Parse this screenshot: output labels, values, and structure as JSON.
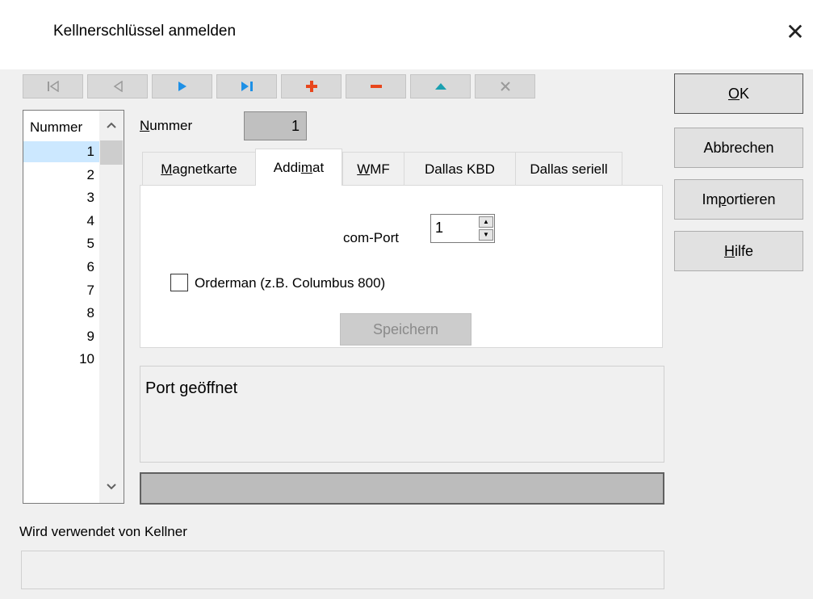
{
  "window": {
    "title": "Kellnerschlüssel anmelden",
    "close_glyph": "✕"
  },
  "nav": [
    {
      "name": "first-record-button",
      "icon": "first-record-icon",
      "color": "#a0a0a0"
    },
    {
      "name": "prev-record-button",
      "icon": "prev-record-icon",
      "color": "#a0a0a0"
    },
    {
      "name": "next-record-button",
      "icon": "next-record-icon",
      "color": "#1e90e6"
    },
    {
      "name": "last-record-button",
      "icon": "last-record-icon",
      "color": "#1e90e6"
    },
    {
      "name": "add-record-button",
      "icon": "plus-icon",
      "color": "#e8461c"
    },
    {
      "name": "delete-record-button",
      "icon": "minus-icon",
      "color": "#e8461c"
    },
    {
      "name": "edit-record-button",
      "icon": "up-triangle-icon",
      "color": "#1aa0b0"
    },
    {
      "name": "cancel-edit-button",
      "icon": "x-icon",
      "color": "#a0a0a0"
    }
  ],
  "buttons": {
    "ok_pre": "",
    "ok_u": "O",
    "ok_post": "K",
    "cancel": "Abbrechen",
    "import_pre": "Im",
    "import_u": "p",
    "import_post": "ortieren",
    "help_pre": "",
    "help_u": "H",
    "help_post": "ilfe"
  },
  "list": {
    "header": "Nummer",
    "selected_index": 0,
    "rows": [
      "1",
      "2",
      "3",
      "4",
      "5",
      "6",
      "7",
      "8",
      "9",
      "10"
    ]
  },
  "nummer": {
    "label_u": "N",
    "label_rest": "ummer",
    "value": "1"
  },
  "tabs": [
    {
      "pre": "",
      "u": "M",
      "post": "agnetkarte"
    },
    {
      "pre": "Addi",
      "u": "m",
      "post": "at"
    },
    {
      "pre": "",
      "u": "W",
      "post": "MF"
    },
    {
      "pre": "Dallas KBD",
      "u": "",
      "post": ""
    },
    {
      "pre": "Dallas seriell",
      "u": "",
      "post": ""
    }
  ],
  "active_tab_index": 1,
  "addimat": {
    "com_port_label": "com-Port",
    "com_port_value": "1",
    "orderman_label": "Orderman (z.B. Columbus 800)",
    "orderman_checked": false,
    "save_label": "Speichern"
  },
  "status_text": "Port geöffnet",
  "progress_fraction": 0,
  "used_by_label": "Wird verwendet von Kellner",
  "used_by_value": ""
}
